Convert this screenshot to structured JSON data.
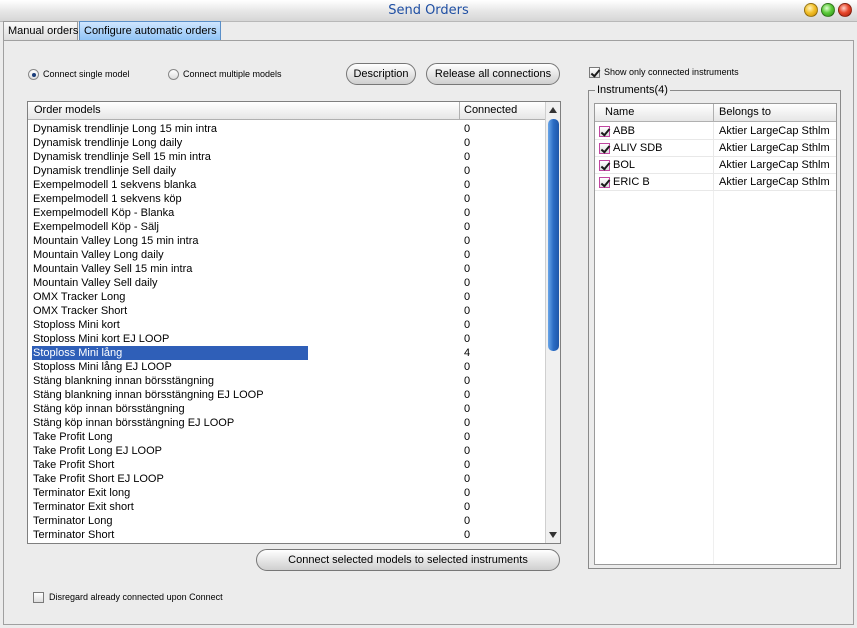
{
  "window": {
    "title": "Send Orders"
  },
  "tabs": [
    {
      "label": "Manual orders",
      "active": false
    },
    {
      "label": "Configure automatic orders",
      "active": true
    }
  ],
  "mode": {
    "single_label": "Connect single model",
    "multiple_label": "Connect multiple models",
    "selected": "single"
  },
  "buttons": {
    "description": "Description",
    "release_all": "Release all connections",
    "connect_selected": "Connect selected models to selected instruments"
  },
  "show_only_connected": {
    "label": "Show only connected instruments",
    "checked": true
  },
  "order_models": {
    "columns": [
      "Order models",
      "Connected"
    ],
    "rows": [
      {
        "name": "Dynamisk trendlinje Long 15 min intra",
        "connected": "0"
      },
      {
        "name": "Dynamisk trendlinje Long daily",
        "connected": "0"
      },
      {
        "name": "Dynamisk trendlinje Sell 15 min intra",
        "connected": "0"
      },
      {
        "name": "Dynamisk trendlinje Sell daily",
        "connected": "0"
      },
      {
        "name": "Exempelmodell 1 sekvens blanka",
        "connected": "0"
      },
      {
        "name": "Exempelmodell 1 sekvens köp",
        "connected": "0"
      },
      {
        "name": "Exempelmodell Köp - Blanka",
        "connected": "0"
      },
      {
        "name": "Exempelmodell Köp - Sälj",
        "connected": "0"
      },
      {
        "name": "Mountain Valley Long 15 min intra",
        "connected": "0"
      },
      {
        "name": "Mountain Valley Long daily",
        "connected": "0"
      },
      {
        "name": "Mountain Valley Sell 15 min intra",
        "connected": "0"
      },
      {
        "name": "Mountain Valley Sell daily",
        "connected": "0"
      },
      {
        "name": "OMX Tracker Long",
        "connected": "0"
      },
      {
        "name": "OMX Tracker Short",
        "connected": "0"
      },
      {
        "name": "Stoploss Mini kort",
        "connected": "0"
      },
      {
        "name": "Stoploss Mini kort EJ LOOP",
        "connected": "0"
      },
      {
        "name": "Stoploss Mini lång",
        "connected": "4",
        "selected": true
      },
      {
        "name": "Stoploss Mini lång EJ LOOP",
        "connected": "0"
      },
      {
        "name": "Stäng blankning innan börsstängning",
        "connected": "0"
      },
      {
        "name": "Stäng blankning innan börsstängning EJ LOOP",
        "connected": "0"
      },
      {
        "name": "Stäng köp innan börsstängning",
        "connected": "0"
      },
      {
        "name": "Stäng köp innan börsstängning EJ LOOP",
        "connected": "0"
      },
      {
        "name": "Take Profit Long",
        "connected": "0"
      },
      {
        "name": "Take Profit Long EJ LOOP",
        "connected": "0"
      },
      {
        "name": "Take Profit Short",
        "connected": "0"
      },
      {
        "name": "Take Profit Short EJ LOOP",
        "connected": "0"
      },
      {
        "name": "Terminator Exit long",
        "connected": "0"
      },
      {
        "name": "Terminator Exit short",
        "connected": "0"
      },
      {
        "name": "Terminator Long",
        "connected": "0"
      },
      {
        "name": "Terminator Short",
        "connected": "0"
      }
    ]
  },
  "instruments": {
    "group_label": "Instruments(4)",
    "columns": [
      "Name",
      "Belongs to"
    ],
    "rows": [
      {
        "name": "ABB",
        "belongs_to": "Aktier LargeCap Sthlm",
        "checked": true
      },
      {
        "name": "ALIV SDB",
        "belongs_to": "Aktier LargeCap Sthlm",
        "checked": true
      },
      {
        "name": "BOL",
        "belongs_to": "Aktier LargeCap Sthlm",
        "checked": true
      },
      {
        "name": "ERIC B",
        "belongs_to": "Aktier LargeCap Sthlm",
        "checked": true
      }
    ]
  },
  "disregard": {
    "label": "Disregard already connected upon Connect",
    "checked": false
  },
  "colors": {
    "selection": "#2f5fb8",
    "title_text": "#1f4fa3",
    "active_tab": "#8dc2f5",
    "scroll_thumb": "#2b6cc4"
  }
}
